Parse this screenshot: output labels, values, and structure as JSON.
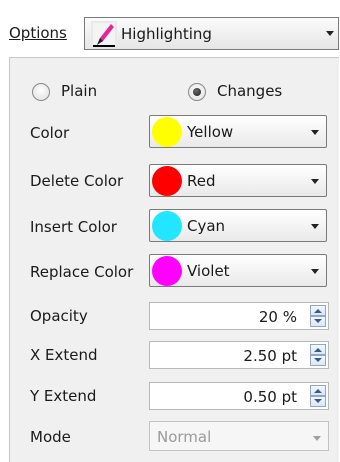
{
  "options": {
    "label": "Options",
    "selected": "Highlighting",
    "icon": "pencil-icon"
  },
  "mode_radio": {
    "plain_label": "Plain",
    "changes_label": "Changes",
    "selected": "Changes"
  },
  "colors": {
    "color": {
      "label": "Color",
      "value": "Yellow",
      "swatch": "#ffff00"
    },
    "delete": {
      "label": "Delete Color",
      "value": "Red",
      "swatch": "#ff0000"
    },
    "insert": {
      "label": "Insert Color",
      "value": "Cyan",
      "swatch": "#22e6ff"
    },
    "replace": {
      "label": "Replace Color",
      "value": "Violet",
      "swatch": "#ff00ff"
    }
  },
  "spinners": {
    "opacity": {
      "label": "Opacity",
      "value": "20 %"
    },
    "x_extend": {
      "label": "X Extend",
      "value": "2.50 pt"
    },
    "y_extend": {
      "label": "Y Extend",
      "value": "0.50 pt"
    }
  },
  "mode": {
    "label": "Mode",
    "value": "Normal",
    "disabled": true
  }
}
